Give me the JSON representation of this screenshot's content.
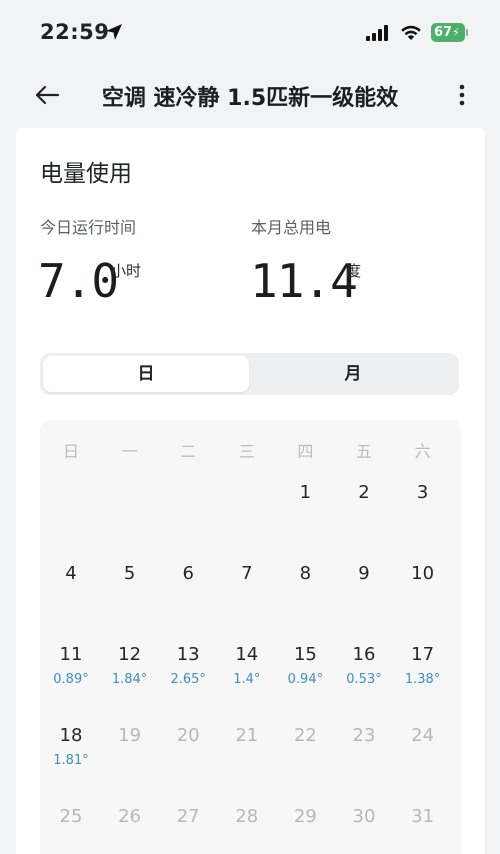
{
  "status_bar": {
    "time": "22:59",
    "battery": "67"
  },
  "nav": {
    "title": "空调 速冷静 1.5匹新一级能效"
  },
  "energy": {
    "section_title": "电量使用",
    "today_runtime": {
      "label": "今日运行时间",
      "value": "7.0",
      "unit": "小时"
    },
    "month_total": {
      "label": "本月总用电",
      "value": "11.4",
      "unit": "度"
    }
  },
  "toggle": {
    "day": "日",
    "month": "月",
    "active": "day"
  },
  "calendar": {
    "weekdays": [
      "日",
      "一",
      "二",
      "三",
      "四",
      "五",
      "六"
    ],
    "days": [
      {
        "d": "1",
        "usage": ""
      },
      {
        "d": "2",
        "usage": ""
      },
      {
        "d": "3",
        "usage": ""
      },
      {
        "d": "4",
        "usage": ""
      },
      {
        "d": "5",
        "usage": ""
      },
      {
        "d": "6",
        "usage": ""
      },
      {
        "d": "7",
        "usage": ""
      },
      {
        "d": "8",
        "usage": ""
      },
      {
        "d": "9",
        "usage": ""
      },
      {
        "d": "10",
        "usage": ""
      },
      {
        "d": "11",
        "usage": "0.89°"
      },
      {
        "d": "12",
        "usage": "1.84°"
      },
      {
        "d": "13",
        "usage": "2.65°"
      },
      {
        "d": "14",
        "usage": "1.4°"
      },
      {
        "d": "15",
        "usage": "0.94°"
      },
      {
        "d": "16",
        "usage": "0.53°"
      },
      {
        "d": "17",
        "usage": "1.38°"
      },
      {
        "d": "18",
        "usage": "1.81°"
      },
      {
        "d": "19",
        "usage": "",
        "future": true
      },
      {
        "d": "20",
        "usage": "",
        "future": true
      },
      {
        "d": "21",
        "usage": "",
        "future": true
      },
      {
        "d": "22",
        "usage": "",
        "future": true
      },
      {
        "d": "23",
        "usage": "",
        "future": true
      },
      {
        "d": "24",
        "usage": "",
        "future": true
      },
      {
        "d": "25",
        "usage": "",
        "future": true
      },
      {
        "d": "26",
        "usage": "",
        "future": true
      },
      {
        "d": "27",
        "usage": "",
        "future": true
      },
      {
        "d": "28",
        "usage": "",
        "future": true
      },
      {
        "d": "29",
        "usage": "",
        "future": true
      },
      {
        "d": "30",
        "usage": "",
        "future": true
      },
      {
        "d": "31",
        "usage": "",
        "future": true
      }
    ]
  }
}
